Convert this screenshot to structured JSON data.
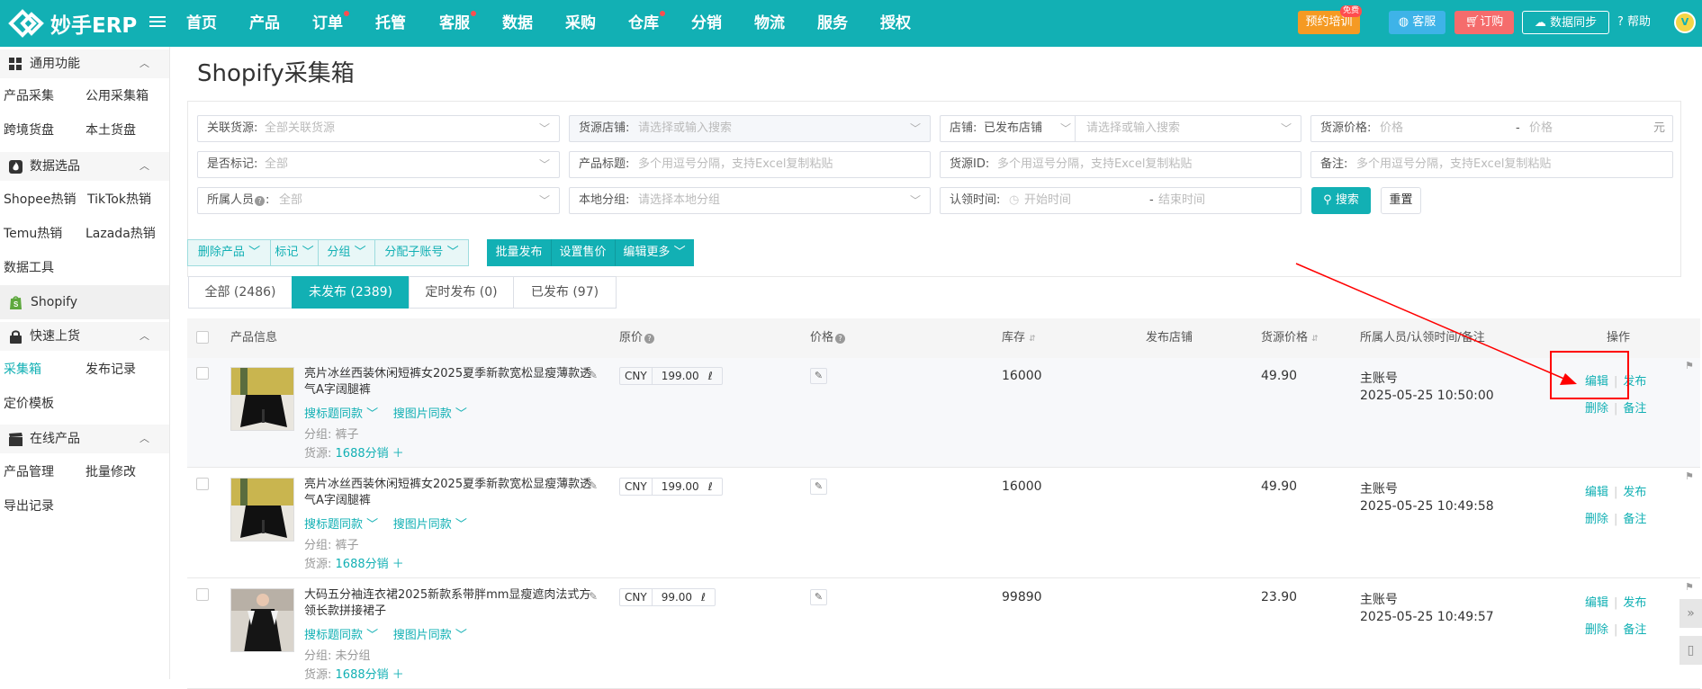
{
  "brand": {
    "name": "妙手ERP"
  },
  "nav": {
    "items": [
      {
        "label": "首页",
        "dot": false
      },
      {
        "label": "产品",
        "dot": false
      },
      {
        "label": "订单",
        "dot": true
      },
      {
        "label": "托管",
        "dot": false
      },
      {
        "label": "客服",
        "dot": true
      },
      {
        "label": "数据",
        "dot": false
      },
      {
        "label": "采购",
        "dot": false
      },
      {
        "label": "仓库",
        "dot": true
      },
      {
        "label": "分销",
        "dot": false
      },
      {
        "label": "物流",
        "dot": false
      },
      {
        "label": "服务",
        "dot": false
      },
      {
        "label": "授权",
        "dot": false
      }
    ],
    "training": "预约培训",
    "training_badge": "免费",
    "service": "客服",
    "order": "订购",
    "sync": "数据同步",
    "help": "帮助"
  },
  "sidebar": {
    "groups": [
      {
        "label": "通用功能",
        "icon": "grid-icon",
        "items": [
          "产品采集",
          "公用采集箱",
          "跨境货盘",
          "本土货盘"
        ]
      },
      {
        "label": "数据选品",
        "icon": "fire-icon",
        "items": [
          "Shopee热销",
          "TikTok热销",
          "Temu热销",
          "Lazada热销",
          "数据工具"
        ]
      },
      {
        "label": "Shopify",
        "icon": "shopify-icon",
        "items": []
      },
      {
        "label": "快速上货",
        "icon": "lock-icon",
        "items": [
          "采集箱",
          "发布记录",
          "定价模板"
        ]
      },
      {
        "label": "在线产品",
        "icon": "clapper-icon",
        "items": [
          "产品管理",
          "批量修改",
          "导出记录"
        ]
      }
    ],
    "active_item": "采集箱"
  },
  "page": {
    "title": "Shopify采集箱"
  },
  "filters": {
    "source_link": {
      "label": "关联货源:",
      "placeholder": "全部关联货源"
    },
    "source_store": {
      "label": "货源店铺:",
      "placeholder": "请选择或输入搜索"
    },
    "store": {
      "label": "店铺:",
      "value": "已发布店铺",
      "placeholder": "请选择或输入搜索"
    },
    "source_price": {
      "label": "货源价格:",
      "min": "价格",
      "dash": "-",
      "max": "价格",
      "unit": "元"
    },
    "marked": {
      "label": "是否标记:",
      "placeholder": "全部"
    },
    "product_title": {
      "label": "产品标题:",
      "placeholder": "多个用逗号分隔，支持Excel复制粘贴"
    },
    "source_id": {
      "label": "货源ID:",
      "placeholder": "多个用逗号分隔，支持Excel复制粘贴"
    },
    "remark": {
      "label": "备注:",
      "placeholder": "多个用逗号分隔，支持Excel复制粘贴"
    },
    "owner": {
      "label": "所属人员",
      "placeholder": "全部"
    },
    "local_group": {
      "label": "本地分组:",
      "placeholder": "请选择本地分组"
    },
    "claim_time": {
      "label": "认领时间:",
      "start": "开始时间",
      "dash": "-",
      "end": "结束时间"
    },
    "search_btn": "搜索",
    "reset_btn": "重置"
  },
  "actions": {
    "delete": "删除产品",
    "mark": "标记",
    "group": "分组",
    "assign": "分配子账号",
    "batch_publish": "批量发布",
    "set_price": "设置售价",
    "edit_more": "编辑更多"
  },
  "tabs": [
    {
      "label": "全部 (2486)",
      "active": false
    },
    {
      "label": "未发布 (2389)",
      "active": true
    },
    {
      "label": "定时发布 (0)",
      "active": false
    },
    {
      "label": "已发布 (97)",
      "active": false
    }
  ],
  "table": {
    "headers": {
      "product": "产品信息",
      "orig_price": "原价",
      "price": "价格",
      "stock": "库存",
      "store": "发布店铺",
      "source_price": "货源价格",
      "owner": "所属人员/认领时间/备注",
      "ops": "操作"
    },
    "rows": [
      {
        "title": "亮片冰丝西装休闲短裤女2025夏季新款宽松显瘦薄款透气A字阔腿裤",
        "search_title": "搜标题同款",
        "search_image": "搜图片同款",
        "group_label": "分组:",
        "group": "裤子",
        "source_label": "货源:",
        "source": "1688分销",
        "currency": "CNY",
        "orig_price": "199.00",
        "stock": "16000",
        "source_price": "49.90",
        "owner": "主账号",
        "time": "2025-05-25 10:50:00",
        "op_edit": "编辑",
        "op_publish": "发布",
        "op_delete": "删除",
        "op_remark": "备注"
      },
      {
        "title": "亮片冰丝西装休闲短裤女2025夏季新款宽松显瘦薄款透气A字阔腿裤",
        "search_title": "搜标题同款",
        "search_image": "搜图片同款",
        "group_label": "分组:",
        "group": "裤子",
        "source_label": "货源:",
        "source": "1688分销",
        "currency": "CNY",
        "orig_price": "199.00",
        "stock": "16000",
        "source_price": "49.90",
        "owner": "主账号",
        "time": "2025-05-25 10:49:58",
        "op_edit": "编辑",
        "op_publish": "发布",
        "op_delete": "删除",
        "op_remark": "备注"
      },
      {
        "title": "大码五分袖连衣裙2025新款系带胖mm显瘦遮肉法式方领长款拼接裙子",
        "search_title": "搜标题同款",
        "search_image": "搜图片同款",
        "group_label": "分组:",
        "group": "未分组",
        "source_label": "货源:",
        "source": "1688分销",
        "currency": "CNY",
        "orig_price": "99.00",
        "stock": "99890",
        "source_price": "23.90",
        "owner": "主账号",
        "time": "2025-05-25 10:49:57",
        "op_edit": "编辑",
        "op_publish": "发布",
        "op_delete": "删除",
        "op_remark": "备注"
      }
    ]
  },
  "colors": {
    "brand": "#12b0b4",
    "annotation": "#ff0000"
  }
}
